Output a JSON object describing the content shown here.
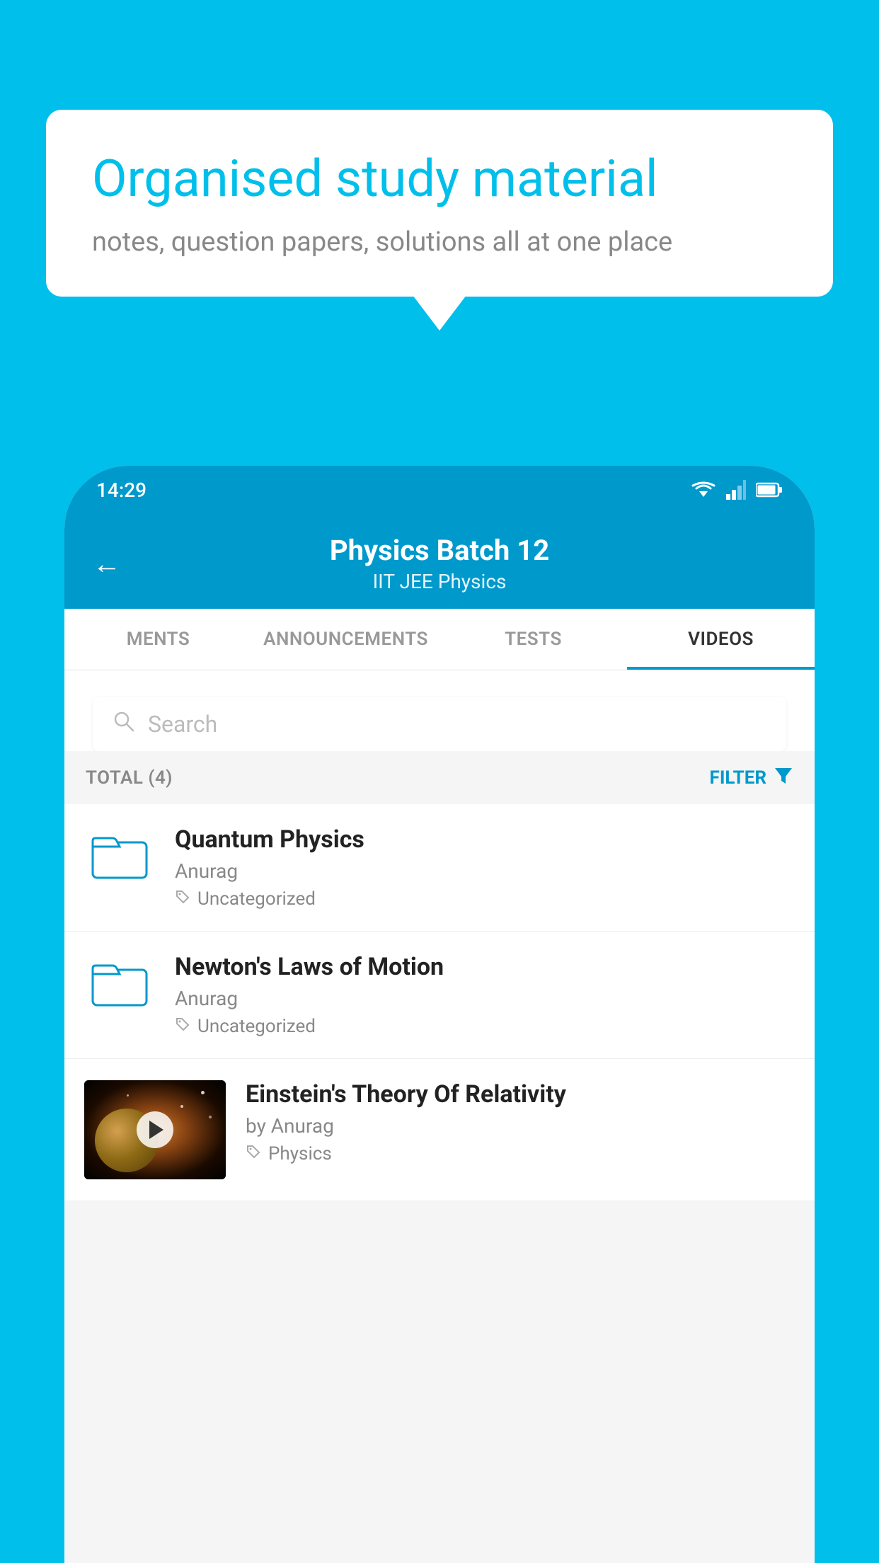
{
  "background_color": "#00BFEA",
  "speech_bubble": {
    "title": "Organised study material",
    "subtitle": "notes, question papers, solutions all at one place"
  },
  "phone": {
    "status_bar": {
      "time": "14:29"
    },
    "header": {
      "title": "Physics Batch 12",
      "subtitle": "IIT JEE   Physics",
      "back_label": "←"
    },
    "tabs": [
      {
        "label": "MENTS",
        "active": false
      },
      {
        "label": "ANNOUNCEMENTS",
        "active": false
      },
      {
        "label": "TESTS",
        "active": false
      },
      {
        "label": "VIDEOS",
        "active": true
      }
    ],
    "search": {
      "placeholder": "Search"
    },
    "filter_bar": {
      "total_label": "TOTAL (4)",
      "filter_label": "FILTER"
    },
    "videos": [
      {
        "title": "Quantum Physics",
        "author": "Anurag",
        "tag": "Uncategorized",
        "type": "folder"
      },
      {
        "title": "Newton's Laws of Motion",
        "author": "Anurag",
        "tag": "Uncategorized",
        "type": "folder"
      },
      {
        "title": "Einstein's Theory Of Relativity",
        "author": "by Anurag",
        "tag": "Physics",
        "type": "video"
      }
    ]
  }
}
